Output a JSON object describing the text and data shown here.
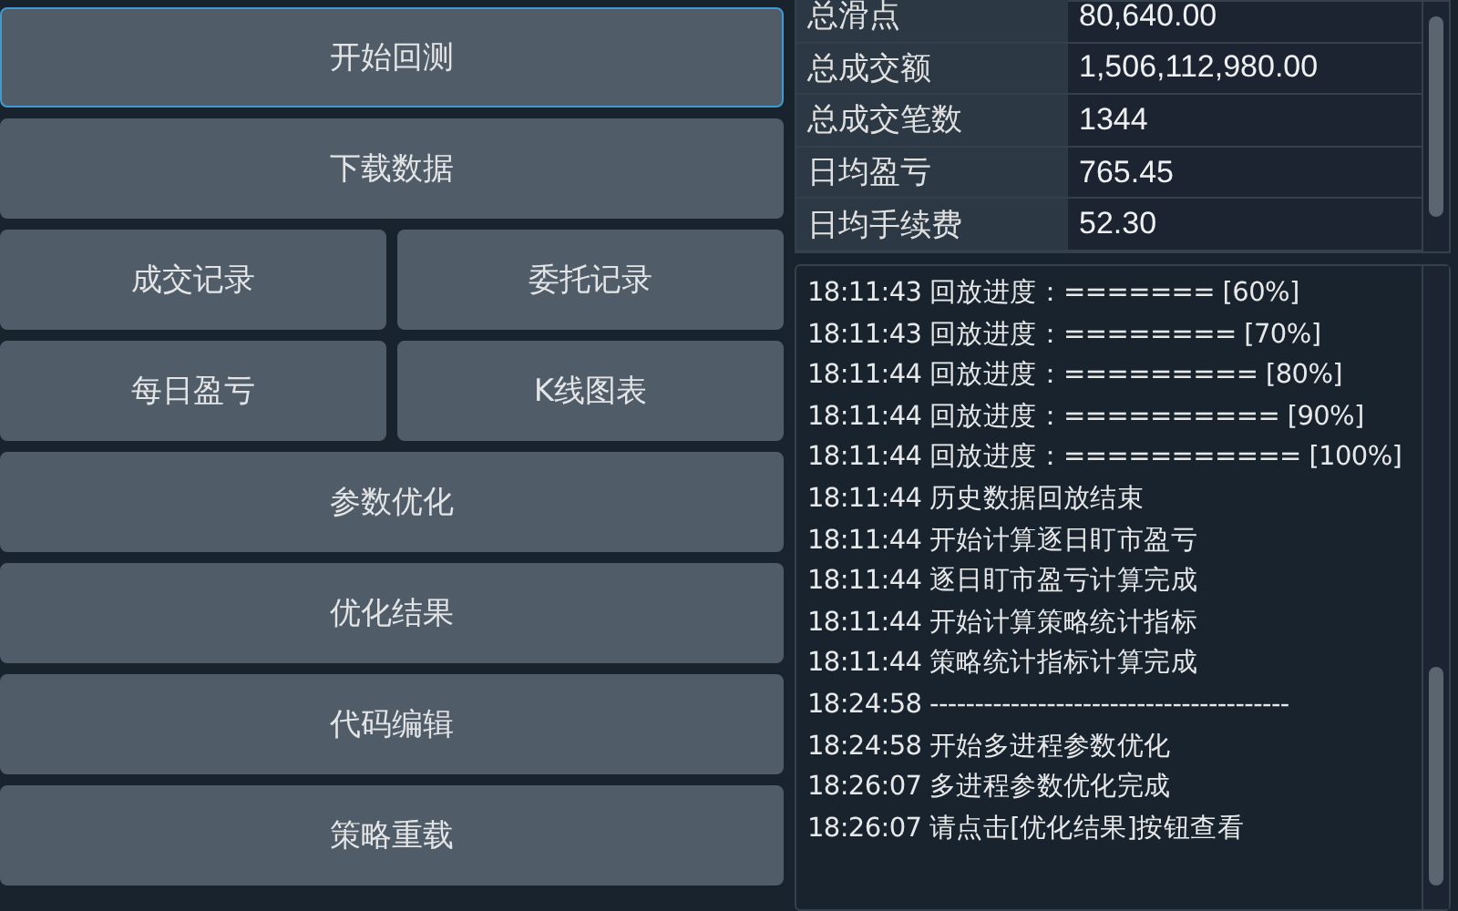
{
  "buttons": [
    {
      "rows": [
        {
          "label": "开始回测",
          "focused": true
        }
      ]
    },
    {
      "rows": [
        {
          "label": "下载数据",
          "focused": false
        }
      ]
    },
    {
      "rows": [
        {
          "label": "成交记录",
          "focused": false
        },
        {
          "label": "委托记录",
          "focused": false
        }
      ]
    },
    {
      "rows": [
        {
          "label": "每日盈亏",
          "focused": false
        },
        {
          "label": "K线图表",
          "focused": false
        }
      ]
    },
    {
      "rows": [
        {
          "label": "参数优化",
          "focused": false
        }
      ]
    },
    {
      "rows": [
        {
          "label": "优化结果",
          "focused": false
        }
      ]
    },
    {
      "rows": [
        {
          "label": "代码编辑",
          "focused": false
        }
      ]
    },
    {
      "rows": [
        {
          "label": "策略重载",
          "focused": false
        }
      ]
    }
  ],
  "statistics": [
    {
      "label": "总滑点",
      "value": "80,640.00"
    },
    {
      "label": "总成交额",
      "value": "1,506,112,980.00"
    },
    {
      "label": "总成交笔数",
      "value": "1344"
    },
    {
      "label": "日均盈亏",
      "value": "765.45"
    },
    {
      "label": "日均手续费",
      "value": "52.30"
    }
  ],
  "log": [
    {
      "time": "18:11:43",
      "text": "回放进度：======= [60%]"
    },
    {
      "time": "18:11:43",
      "text": "回放进度：======== [70%]"
    },
    {
      "time": "18:11:44",
      "text": "回放进度：========= [80%]"
    },
    {
      "time": "18:11:44",
      "text": "回放进度：========== [90%]"
    },
    {
      "time": "18:11:44",
      "text": "回放进度：=========== [100%]"
    },
    {
      "time": "18:11:44",
      "text": "历史数据回放结束"
    },
    {
      "time": "18:11:44",
      "text": "开始计算逐日盯市盈亏"
    },
    {
      "time": "18:11:44",
      "text": "逐日盯市盈亏计算完成"
    },
    {
      "time": "18:11:44",
      "text": "开始计算策略统计指标"
    },
    {
      "time": "18:11:44",
      "text": "策略统计指标计算完成"
    },
    {
      "time": "18:24:58",
      "text": "----------------------------------------"
    },
    {
      "time": "18:24:58",
      "text": "开始多进程参数优化"
    },
    {
      "time": "18:26:07",
      "text": "多进程参数优化完成"
    },
    {
      "time": "18:26:07",
      "text": "请点击[优化结果]按钮查看"
    }
  ]
}
